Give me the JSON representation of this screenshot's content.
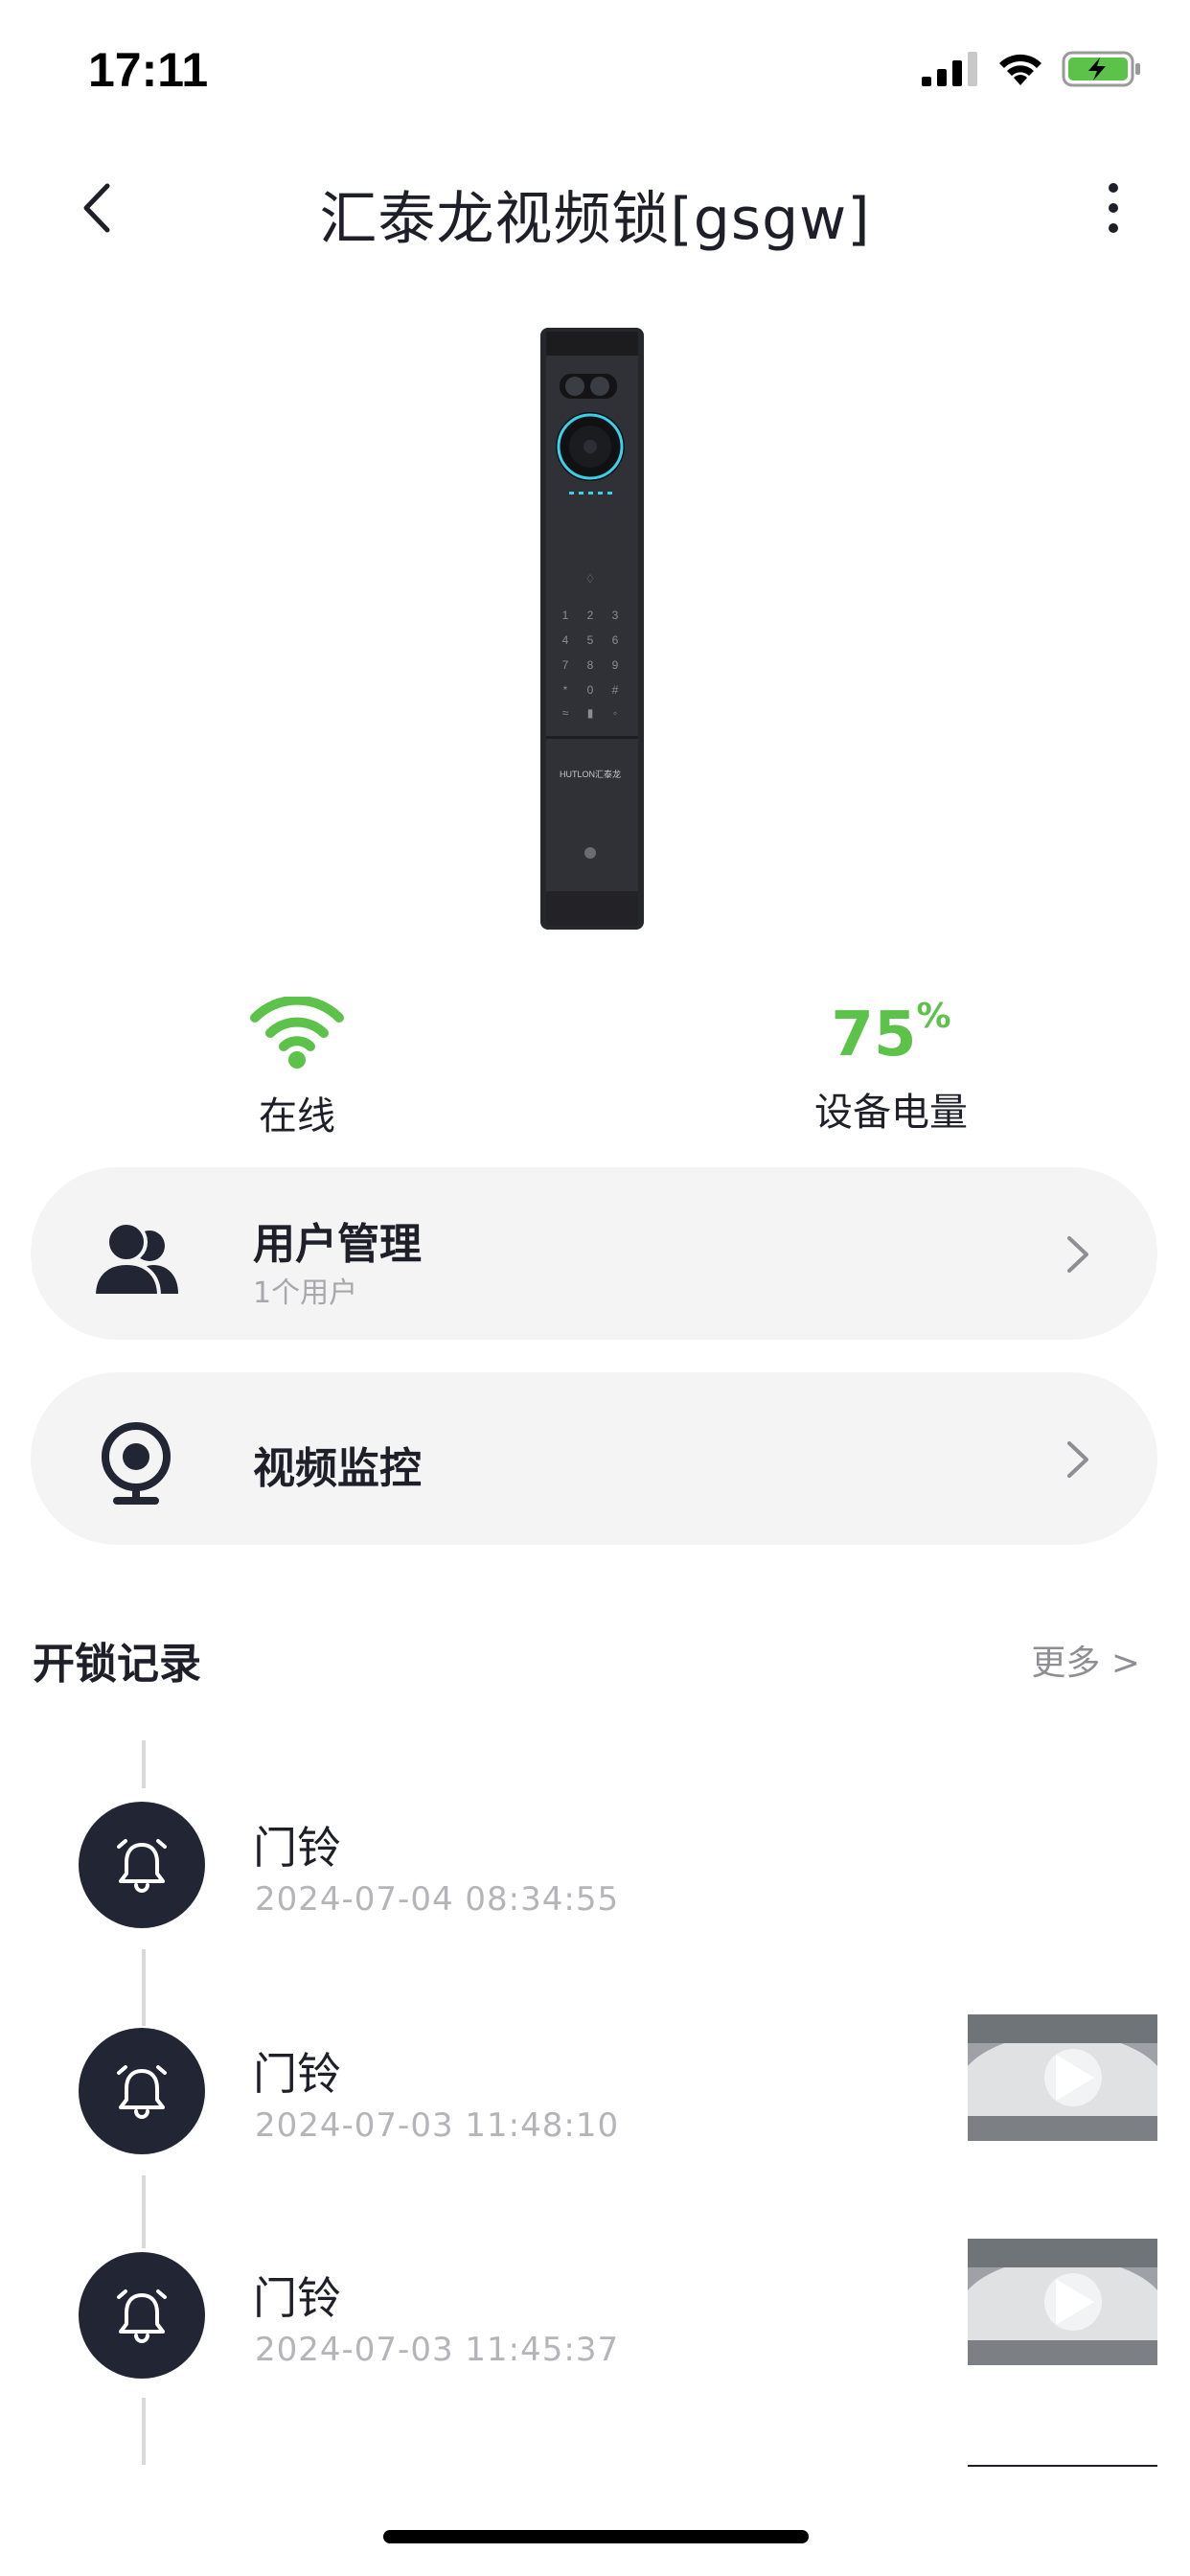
{
  "status_bar": {
    "time": "17:11",
    "icons": [
      "cellular-signal-icon",
      "wifi-icon",
      "battery-charging-icon"
    ]
  },
  "header": {
    "title": "汇泰龙视频锁[gsgw]",
    "back_icon": "chevron-left-icon",
    "more_icon": "vertical-ellipsis-icon"
  },
  "device": {
    "brand_text": "HUTLON汇泰龙",
    "keypad": [
      "1",
      "2",
      "3",
      "4",
      "5",
      "6",
      "7",
      "8",
      "9",
      "*",
      "0",
      "#"
    ]
  },
  "stats": {
    "online": {
      "label": "在线",
      "icon": "wifi-icon",
      "color": "#5cc24a"
    },
    "battery": {
      "value": "75",
      "unit": "%",
      "label": "设备电量",
      "color": "#5cc24a"
    }
  },
  "cards": {
    "users": {
      "title": "用户管理",
      "subtitle": "1个用户",
      "icon": "users-icon"
    },
    "video": {
      "title": "视频监控",
      "icon": "camera-icon"
    }
  },
  "records_section": {
    "title": "开锁记录",
    "more_label": "更多 >"
  },
  "records": [
    {
      "title": "门铃",
      "time": "2024-07-04 08:34:55",
      "icon": "bell-icon",
      "has_video": false
    },
    {
      "title": "门铃",
      "time": "2024-07-03 11:48:10",
      "icon": "bell-icon",
      "has_video": true
    },
    {
      "title": "门铃",
      "time": "2024-07-03 11:45:37",
      "icon": "bell-icon",
      "has_video": true
    }
  ]
}
